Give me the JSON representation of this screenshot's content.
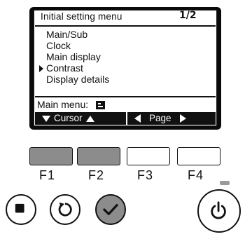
{
  "screen": {
    "title": "Initial setting menu",
    "page_indicator": "1/2",
    "menu_items": [
      {
        "label": "Main/Sub",
        "selected": false
      },
      {
        "label": "Clock",
        "selected": false
      },
      {
        "label": "Main display",
        "selected": false
      },
      {
        "label": "Contrast",
        "selected": true
      },
      {
        "label": "Display details",
        "selected": false
      }
    ],
    "main_menu_label": "Main menu:",
    "main_menu_icon": "main-menu-glyph-icon",
    "function_bar": {
      "cursor_label": "Cursor",
      "page_label": "Page"
    }
  },
  "function_keys": [
    {
      "label": "F1",
      "style": "filled"
    },
    {
      "label": "F2",
      "style": "filled"
    },
    {
      "label": "F3",
      "style": "empty"
    },
    {
      "label": "F4",
      "style": "empty"
    }
  ],
  "buttons": {
    "menu": "menu-square-icon",
    "return": "return-arrow-icon",
    "select": "checkmark-icon",
    "power": "power-icon"
  },
  "colors": {
    "lcd_bezel": "#0a0a0a",
    "key_fill": "#8c8c8c",
    "operation_lamp": "#9a9a9a"
  }
}
